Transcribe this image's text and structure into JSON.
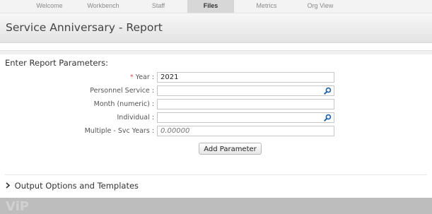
{
  "nav": {
    "tabs": [
      {
        "label": "Welcome",
        "active": false
      },
      {
        "label": "Workbench",
        "active": false
      },
      {
        "label": "Staff",
        "active": false
      },
      {
        "label": "Files",
        "active": true
      },
      {
        "label": "Metrics",
        "active": false
      },
      {
        "label": "Org View",
        "active": false
      }
    ]
  },
  "header": {
    "title": "Service Anniversary - Report"
  },
  "params": {
    "section_title": "Enter Report Parameters:",
    "required_mark": "*",
    "year": {
      "label": "Year :",
      "value": "2021"
    },
    "personnel_service": {
      "label": "Personnel Service :",
      "value": ""
    },
    "month": {
      "label": "Month (numeric) :",
      "value": ""
    },
    "individual": {
      "label": "Individual :",
      "value": ""
    },
    "multiple_svc_years": {
      "label": "Multiple - Svc Years :",
      "placeholder": "0.00000"
    },
    "add_button": "Add Parameter"
  },
  "output": {
    "label": "Output Options and Templates"
  },
  "footer": {
    "logo_text": "ViP"
  },
  "colors": {
    "accent_required": "#d9534f",
    "lookup_icon": "#1f5fa8"
  },
  "icons": [
    "search-icon",
    "chevron-right-icon"
  ]
}
